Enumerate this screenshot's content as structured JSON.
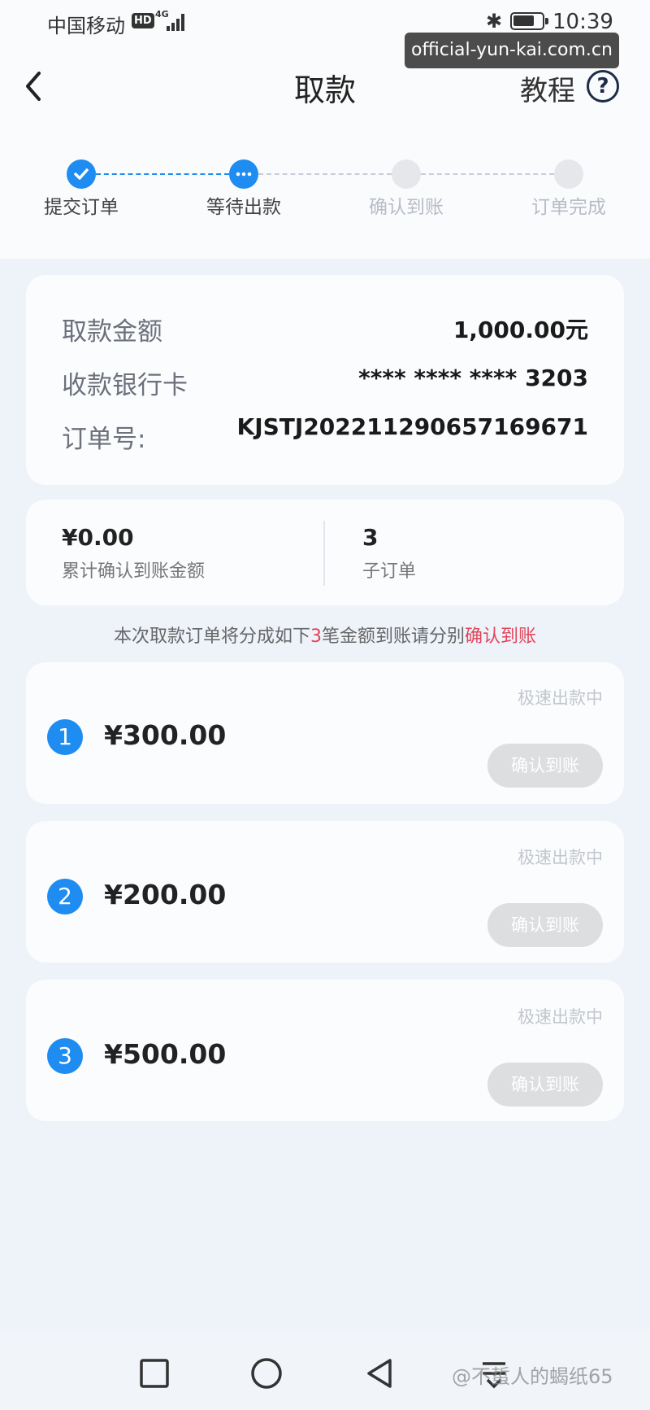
{
  "status_bar": {
    "carrier": "中国移动",
    "hd": "HD",
    "network": "4G",
    "time": "10:39"
  },
  "watermark_top": "official-yun-kai.com.cn",
  "header": {
    "title": "取款",
    "tutorial": "教程",
    "help": "?"
  },
  "steps": [
    {
      "label": "提交订单",
      "state": "done"
    },
    {
      "label": "等待出款",
      "state": "active"
    },
    {
      "label": "确认到账",
      "state": "pending"
    },
    {
      "label": "订单完成",
      "state": "pending"
    }
  ],
  "order": {
    "amount_label": "取款金额",
    "amount_value": "1,000.00元",
    "card_label": "收款银行卡",
    "card_value": "**** **** **** 3203",
    "order_no_label": "订单号:",
    "order_no_value": "KJSTJ20221129065716967​1"
  },
  "stats": {
    "confirmed_value": "¥0.00",
    "confirmed_label": "累计确认到账金额",
    "sub_count_value": "3",
    "sub_count_label": "子订单"
  },
  "notice": {
    "prefix": "本次取款订单将分成如下",
    "count": "3",
    "middle": "笔金额到账请分别",
    "action": "确认到账"
  },
  "sub_orders": [
    {
      "index": "1",
      "amount": "¥300.00",
      "status": "极速出款中",
      "button": "确认到账"
    },
    {
      "index": "2",
      "amount": "¥200.00",
      "status": "极速出款中",
      "button": "确认到账"
    },
    {
      "index": "3",
      "amount": "¥500.00",
      "status": "极速出款中",
      "button": "确认到账"
    }
  ],
  "watermark_bottom": "@不蜇人的蝎纸65",
  "colors": {
    "accent": "#1e8cf0",
    "highlight": "#e0455a",
    "disabled_button": "#dcdedf"
  }
}
